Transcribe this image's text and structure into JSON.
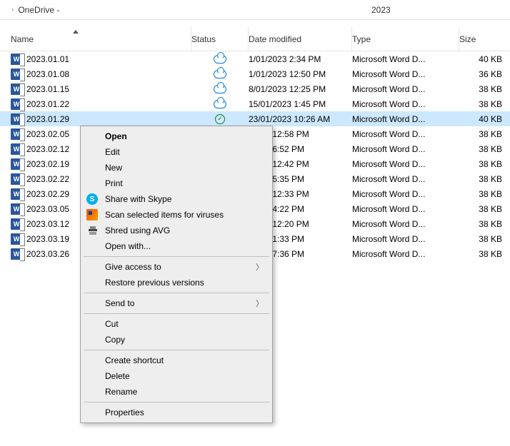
{
  "breadcrumb": {
    "parent": "",
    "current": "OneDrive -",
    "folder": "2023"
  },
  "columns": {
    "name": "Name",
    "status": "Status",
    "date": "Date modified",
    "type": "Type",
    "size": "Size"
  },
  "rows": [
    {
      "name": "2023.01.01",
      "status": "cloud",
      "date": "1/01/2023 2:34 PM",
      "type": "Microsoft Word D...",
      "size": "40 KB",
      "selected": false
    },
    {
      "name": "2023.01.08",
      "status": "cloud",
      "date": "1/01/2023 12:50 PM",
      "type": "Microsoft Word D...",
      "size": "36 KB",
      "selected": false
    },
    {
      "name": "2023.01.15",
      "status": "cloud",
      "date": "8/01/2023 12:25 PM",
      "type": "Microsoft Word D...",
      "size": "38 KB",
      "selected": false
    },
    {
      "name": "2023.01.22",
      "status": "cloud",
      "date": "15/01/2023 1:45 PM",
      "type": "Microsoft Word D...",
      "size": "38 KB",
      "selected": false
    },
    {
      "name": "2023.01.29",
      "status": "check",
      "date": "23/01/2023 10:26 AM",
      "type": "Microsoft Word D...",
      "size": "40 KB",
      "selected": true
    },
    {
      "name": "2023.02.05",
      "status": "",
      "date": "/2023 12:58 PM",
      "type": "Microsoft Word D...",
      "size": "38 KB",
      "selected": false
    },
    {
      "name": "2023.02.12",
      "status": "",
      "date": "/2023 6:52 PM",
      "type": "Microsoft Word D...",
      "size": "38 KB",
      "selected": false
    },
    {
      "name": "2023.02.19",
      "status": "",
      "date": "/2023 12:42 PM",
      "type": "Microsoft Word D...",
      "size": "38 KB",
      "selected": false
    },
    {
      "name": "2023.02.22",
      "status": "",
      "date": "/2023 5:35 PM",
      "type": "Microsoft Word D...",
      "size": "38 KB",
      "selected": false
    },
    {
      "name": "2023.02.29",
      "status": "",
      "date": "/2023 12:33 PM",
      "type": "Microsoft Word D...",
      "size": "38 KB",
      "selected": false
    },
    {
      "name": "2023.03.05",
      "status": "",
      "date": "/2023 4:22 PM",
      "type": "Microsoft Word D...",
      "size": "38 KB",
      "selected": false
    },
    {
      "name": "2023.03.12",
      "status": "",
      "date": "/2023 12:20 PM",
      "type": "Microsoft Word D...",
      "size": "38 KB",
      "selected": false
    },
    {
      "name": "2023.03.19",
      "status": "",
      "date": "/2023 1:33 PM",
      "type": "Microsoft Word D...",
      "size": "38 KB",
      "selected": false
    },
    {
      "name": "2023.03.26",
      "status": "",
      "date": "/2023 7:36 PM",
      "type": "Microsoft Word D...",
      "size": "38 KB",
      "selected": false
    }
  ],
  "menu": {
    "open": "Open",
    "edit": "Edit",
    "new": "New",
    "print": "Print",
    "skype": "Share with Skype",
    "scan": "Scan selected items for viruses",
    "shred": "Shred using AVG",
    "openwith": "Open with...",
    "giveaccess": "Give access to",
    "restore": "Restore previous versions",
    "sendto": "Send to",
    "cut": "Cut",
    "copy": "Copy",
    "shortcut": "Create shortcut",
    "delete": "Delete",
    "rename": "Rename",
    "properties": "Properties"
  }
}
